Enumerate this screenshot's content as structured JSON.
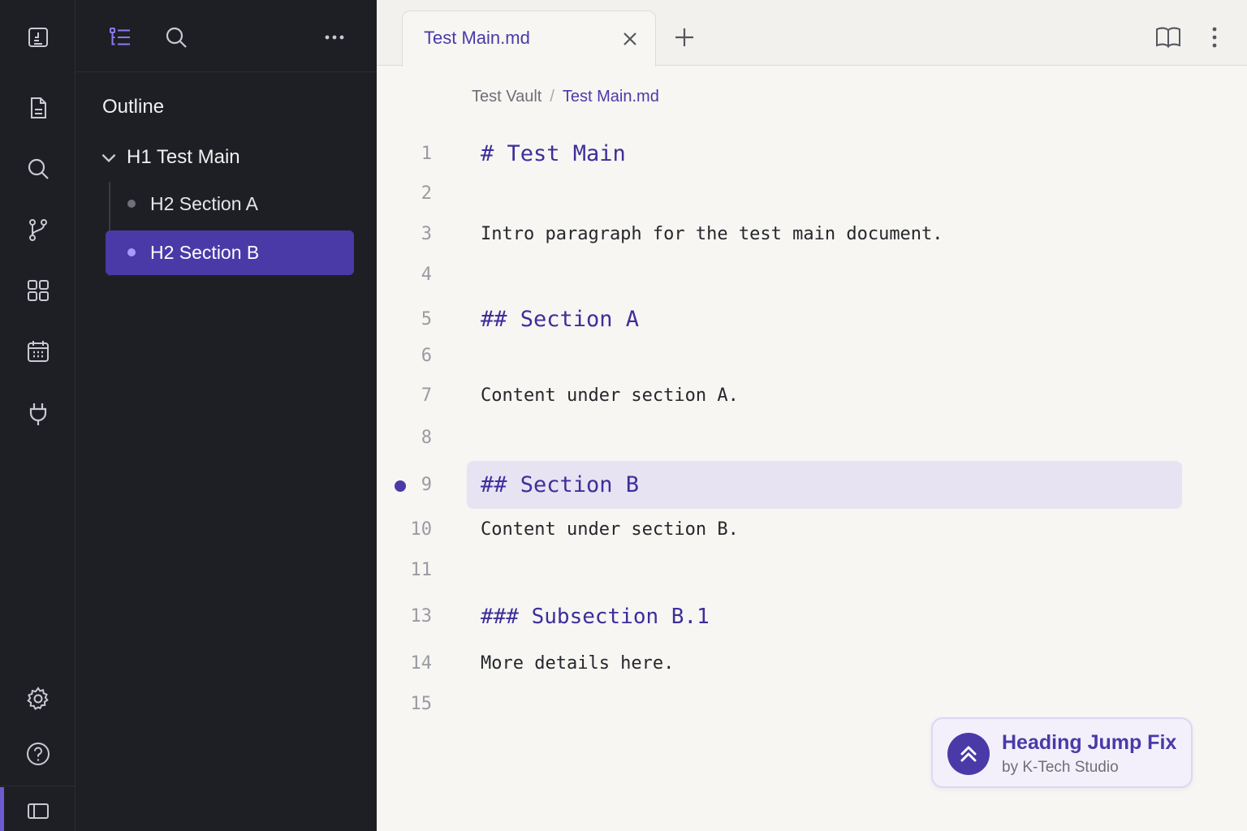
{
  "ribbon": {
    "icons": [
      "vault-switcher-icon",
      "file-icon",
      "search-icon",
      "graph-branch-icon",
      "grid-icon",
      "calendar-icon",
      "plug-icon",
      "gear-icon",
      "help-icon",
      "sidebar-toggle-icon"
    ]
  },
  "sidepanel": {
    "title": "Outline",
    "outline": {
      "h1": "H1 Test Main",
      "items": [
        {
          "label": "H2 Section A",
          "active": false
        },
        {
          "label": "H2 Section B",
          "active": true
        }
      ]
    }
  },
  "tab": {
    "label": "Test Main.md"
  },
  "breadcrumb": {
    "vault": "Test Vault",
    "separator": "/",
    "file": "Test Main.md"
  },
  "editor": {
    "active_line": "9",
    "lines": [
      {
        "num": "1",
        "text": "# Test Main",
        "kind": "h1"
      },
      {
        "num": "2",
        "text": "",
        "kind": "p"
      },
      {
        "num": "3",
        "text": "Intro paragraph for the test main document.",
        "kind": "p"
      },
      {
        "num": "4",
        "text": "",
        "kind": "p"
      },
      {
        "num": "5",
        "text": "## Section A",
        "kind": "h2"
      },
      {
        "num": "6",
        "text": "",
        "kind": "p"
      },
      {
        "num": "7",
        "text": "Content under section A.",
        "kind": "p"
      },
      {
        "num": "8",
        "text": "",
        "kind": "p"
      },
      {
        "num": "9",
        "text": "## Section B",
        "kind": "h2"
      },
      {
        "num": "10",
        "text": "Content under section B.",
        "kind": "p"
      },
      {
        "num": "11",
        "text": "",
        "kind": "p"
      },
      {
        "num": "13",
        "text": "### Subsection B.1",
        "kind": "h3"
      },
      {
        "num": "14",
        "text": "More details here.",
        "kind": "p"
      },
      {
        "num": "15",
        "text": "",
        "kind": "p"
      }
    ]
  },
  "badge": {
    "title": "Heading Jump Fix",
    "subtitle": "by K-Tech Studio"
  },
  "colors": {
    "accent": "#4a3aa8",
    "sidebar_bg": "#1e1f24",
    "editor_bg": "#f7f6f3",
    "active_line_bg": "#e7e3f2"
  }
}
